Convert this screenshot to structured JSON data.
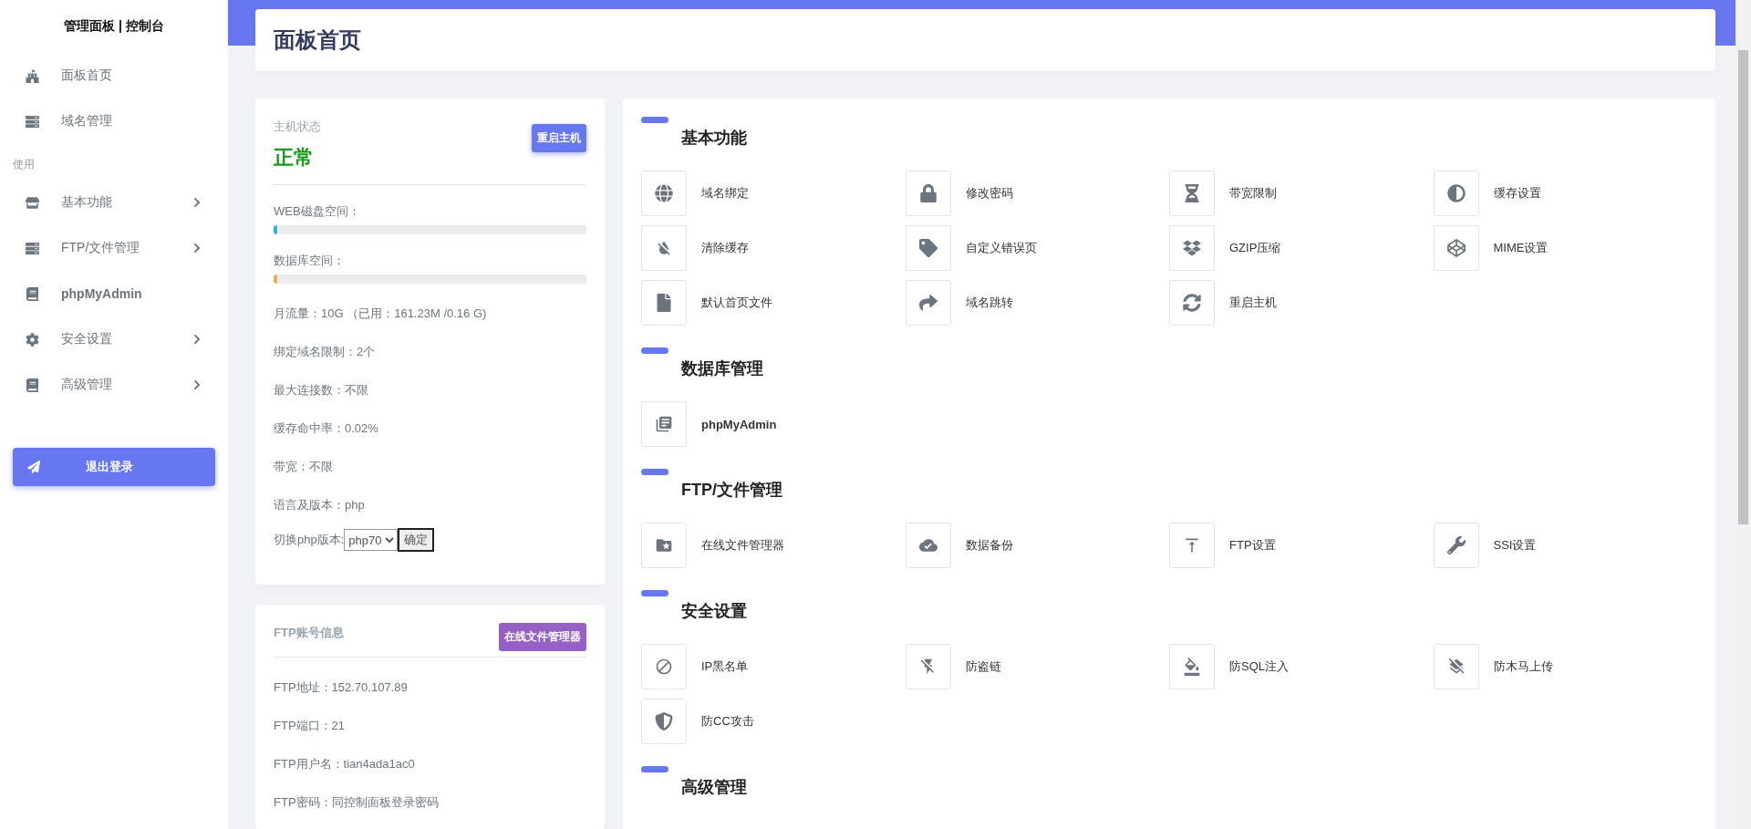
{
  "sidebar": {
    "brand": "管理面板 | 控制台",
    "top_items": [
      {
        "label": "面板首页",
        "has_submenu": false
      },
      {
        "label": "域名管理",
        "has_submenu": false
      }
    ],
    "section_label": "使用",
    "items": [
      {
        "label": "基本功能",
        "has_submenu": true
      },
      {
        "label": "FTP/文件管理",
        "has_submenu": true
      },
      {
        "label": "phpMyAdmin",
        "has_submenu": false
      },
      {
        "label": "安全设置",
        "has_submenu": true
      },
      {
        "label": "高级管理",
        "has_submenu": true
      }
    ],
    "logout_button": "退出登录"
  },
  "header": {
    "title": "面板首页"
  },
  "host_card": {
    "title": "主机状态",
    "status": "正常",
    "restart_button": "重启主机",
    "usage": [
      {
        "label": "WEB磁盘空间：",
        "level": 0.01,
        "color": "#29b6d6"
      },
      {
        "label": "数据库空间：",
        "level": 0.01,
        "color": "#f0ad4e"
      }
    ],
    "info": [
      "月流量：10G （已用：161.23M /0.16 G)",
      "绑定域名限制：2个",
      "最大连接数：不限",
      "缓存命中率：0.02%",
      "带宽：不限",
      "语言及版本：php"
    ],
    "php_switch": {
      "label": "切换php版本:",
      "value": "php70",
      "confirm_button": "确定"
    }
  },
  "ftp_card": {
    "title": "FTP账号信息",
    "file_manager_button": "在线文件管理器",
    "info": [
      "FTP地址：152.70.107.89",
      "FTP端口：21",
      "FTP用户名：tian4ada1ac0",
      "FTP密码：同控制面板登录密码"
    ]
  },
  "sections": [
    {
      "title": "基本功能",
      "items": [
        {
          "label": "域名绑定"
        },
        {
          "label": "修改密码"
        },
        {
          "label": "带宽限制"
        },
        {
          "label": "缓存设置"
        },
        {
          "label": "清除缓存"
        },
        {
          "label": "自定义错误页"
        },
        {
          "label": "GZIP压缩"
        },
        {
          "label": "MIME设置"
        },
        {
          "label": "默认首页文件"
        },
        {
          "label": "域名跳转"
        },
        {
          "label": "重启主机"
        }
      ]
    },
    {
      "title": "数据库管理",
      "items": [
        {
          "label": "phpMyAdmin"
        }
      ]
    },
    {
      "title": "FTP/文件管理",
      "items": [
        {
          "label": "在线文件管理器"
        },
        {
          "label": "数据备份"
        },
        {
          "label": "FTP设置"
        },
        {
          "label": "SSI设置"
        }
      ]
    },
    {
      "title": "安全设置",
      "items": [
        {
          "label": "IP黑名单"
        },
        {
          "label": "防盗链"
        },
        {
          "label": "防SQL注入"
        },
        {
          "label": "防木马上传"
        },
        {
          "label": "防CC攻击"
        }
      ]
    },
    {
      "title": "高级管理"
    }
  ]
}
